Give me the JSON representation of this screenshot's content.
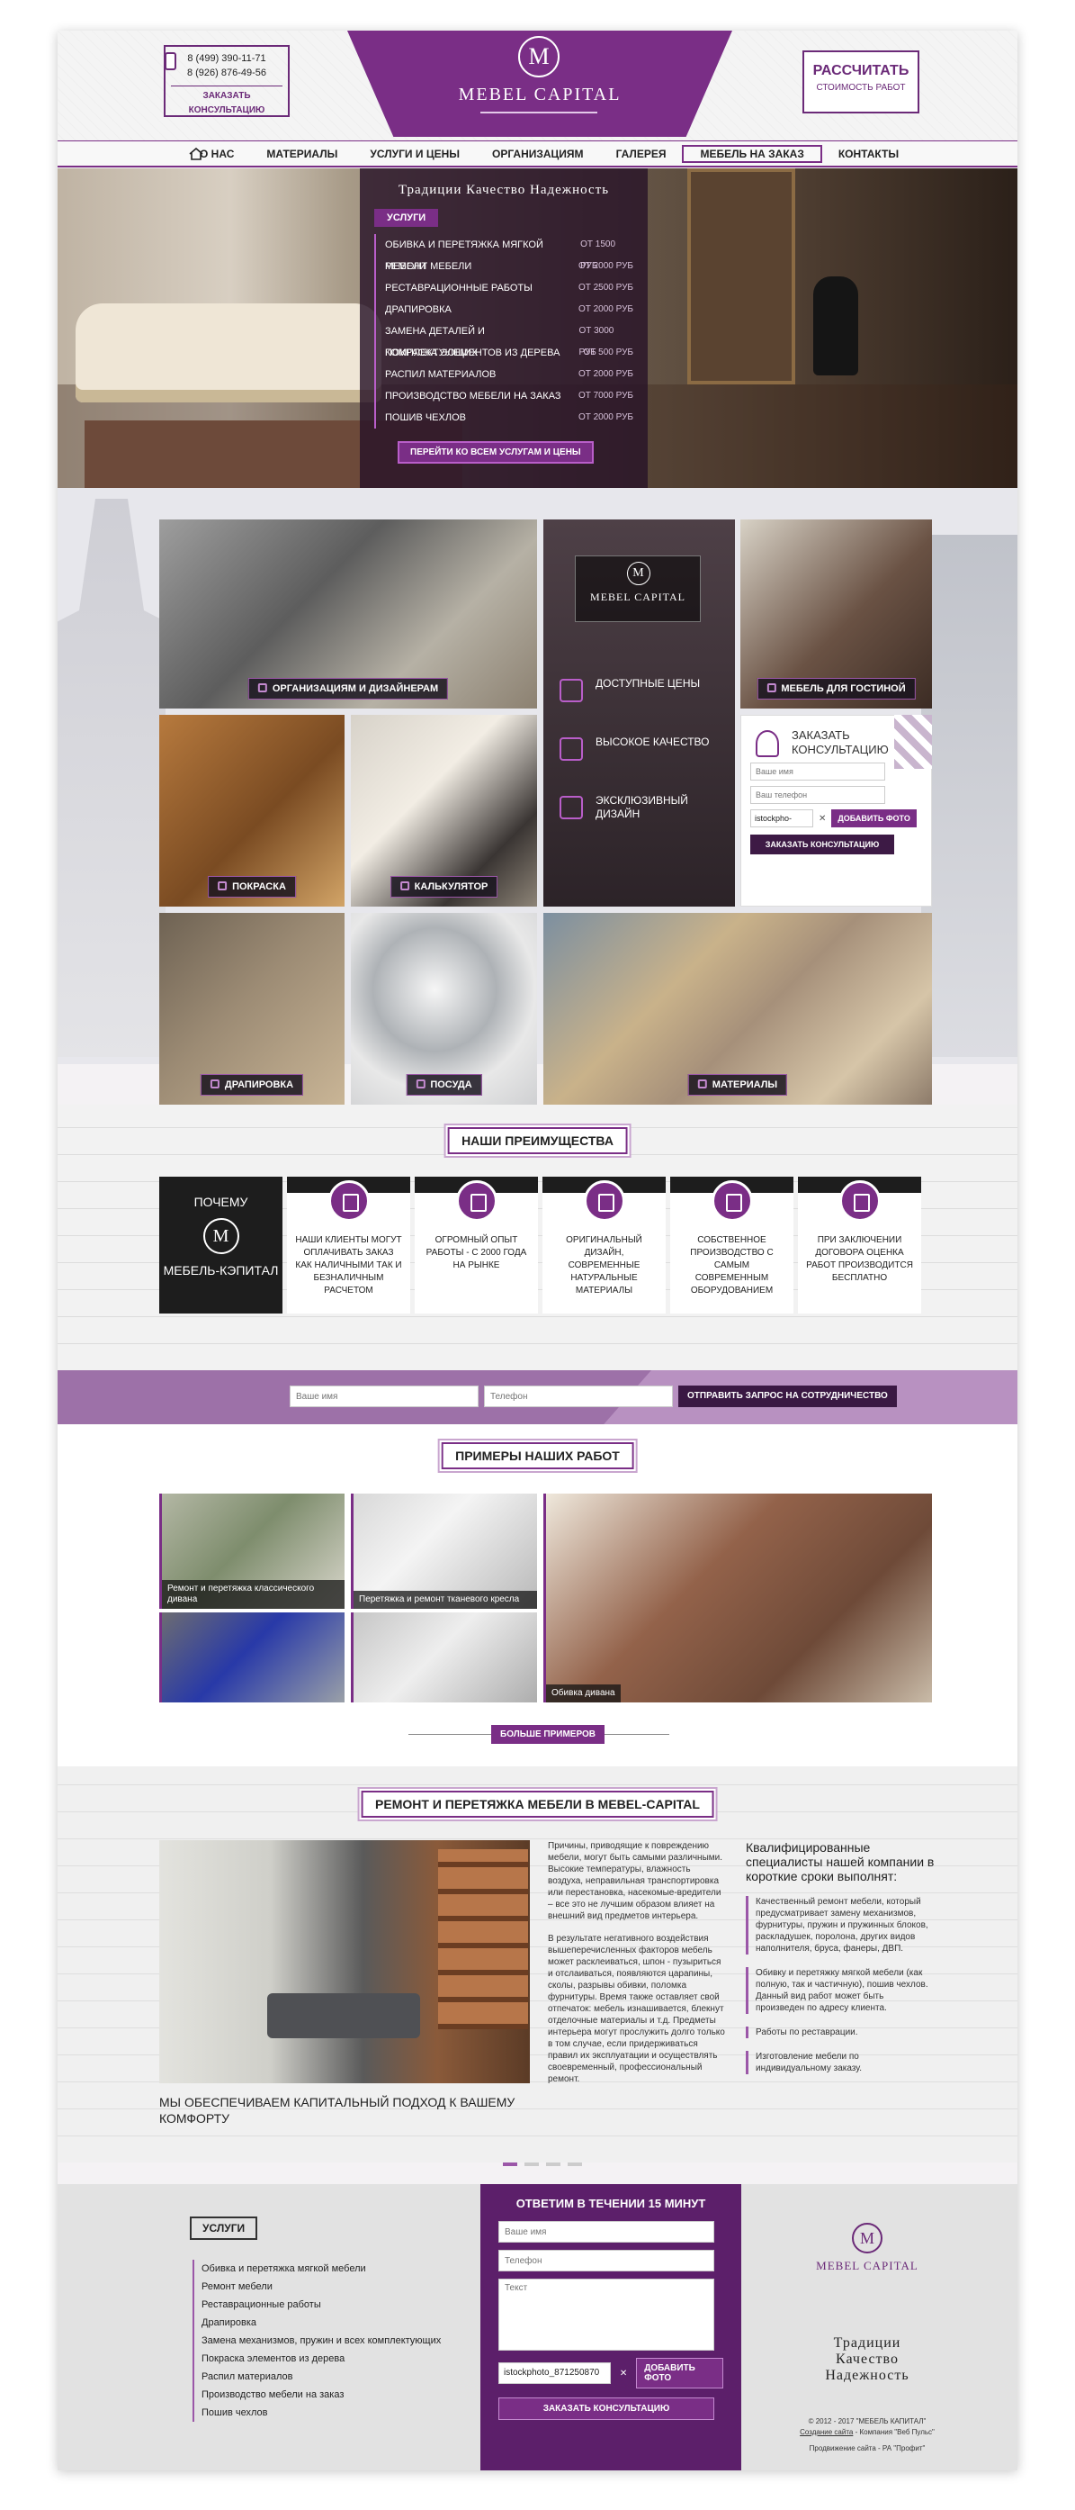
{
  "header": {
    "phones": [
      "8 (499) 390-11-71",
      "8 (926) 876-49-56"
    ],
    "callback_label": "Заказать консультацию",
    "logo_letter": "M",
    "logo_text": "MEBEL CAPITAL",
    "calc_big": "Рассчитать",
    "calc_small": "стоимость работ"
  },
  "nav": {
    "items": [
      "О нас",
      "Материалы",
      "Услуги и цены",
      "Организациям",
      "Галерея",
      "Мебель на заказ",
      "Контакты"
    ],
    "active_index": 5
  },
  "hero": {
    "motto": "Традиции  Качество  Надежность",
    "services_tag": "Услуги",
    "services": [
      {
        "name": "Обивка и перетяжка мягкой мебели",
        "price": "от 1500 руб"
      },
      {
        "name": "Ремонт мебели",
        "price": "от 2000 руб"
      },
      {
        "name": "Реставрационные работы",
        "price": "от 2500 руб"
      },
      {
        "name": "Драпировка",
        "price": "от 2000 руб"
      },
      {
        "name": "Замена деталей и комплектующих",
        "price": "от 3000 руб"
      },
      {
        "name": "Покраска элементов из дерева",
        "price": "от 500 руб"
      },
      {
        "name": "Распил материалов",
        "price": "от 2000 руб"
      },
      {
        "name": "Производство мебели на заказ",
        "price": "от 7000 руб"
      },
      {
        "name": "Пошив чехлов",
        "price": "от 2000 руб"
      }
    ],
    "all_services_label": "Перейти ко всем услугам и цены"
  },
  "tiles": {
    "organizations": "Организациям и дизайнерам",
    "living_room": "Мебель для гостиной",
    "painting": "Покраска",
    "calculator": "Калькулятор",
    "draping": "Драпировка",
    "dishes": "Посуда",
    "materials": "Материалы",
    "brand_logo_text": "MEBEL CAPITAL",
    "features": [
      "Доступные цены",
      "Высокое качество",
      "Эксклюзивный дизайн"
    ]
  },
  "consult": {
    "title": "Заказать консультацию",
    "name_placeholder": "Ваше имя",
    "phone_placeholder": "Ваш телефон",
    "file_name": "istockpho-",
    "add_photo": "Добавить фото",
    "submit": "Заказать консультацию"
  },
  "advantages": {
    "title": "Наши преимущества",
    "why_top": "Почему",
    "why_bottom": "Мебель-Кэпитал",
    "items": [
      "Наши клиенты могут оплачивать заказ как наличными так и безналичным расчетом",
      "Огромный опыт работы - с 2000 года на рынке",
      "Оригинальный дизайн, современные натуральные материалы",
      "Собственное производство с самым современным оборудованием",
      "При заключении договора оценка работ производится бесплатно"
    ]
  },
  "coop_form": {
    "name_placeholder": "Ваше имя",
    "phone_placeholder": "Телефон",
    "submit": "Отправить запрос на сотрудничество"
  },
  "works": {
    "title": "Примеры наших работ",
    "items": [
      "Ремонт и перетяжка классического дивана",
      "Перетяжка и ремонт тканевого кресла",
      "Обивка дивана"
    ],
    "more_label": "Больше примеров"
  },
  "repair": {
    "title": "Ремонт и перетяжка мебели в Mebel-Capital",
    "caption": "Мы обеспечиваем капитальный подход к вашему комфорту",
    "paragraph1": "Причины, приводящие к повреждению мебели, могут быть самыми различными. Высокие температуры, влажность воздуха, неправильная транспортировка или перестановка, насекомые-вредители – все это не лучшим образом влияет на внешний вид предметов интерьера.",
    "paragraph2": "В результате негативного воздействия вышеперечисленных факторов мебель может расклеиваться, шпон - пузыриться и отслаиваться, появляются царапины, сколы, разрывы обивки, поломка фурнитуры. Время также оставляет свой отпечаток: мебель изнашивается, блекнут отделочные материалы и т.д. Предметы интерьера могут прослужить долго только в том случае, если придерживаться правил их эксплуатации и осуществлять своевременный, профессиональный ремонт.",
    "qual_title": "Квалифицированные специалисты нашей компании в короткие сроки выполнят:",
    "qual_items": [
      "Качественный ремонт мебели, который предусматривает замену механизмов, фурнитуры, пружин и пружинных блоков, раскладушек, поролона, других видов наполнителя, бруса, фанеры, ДВП.",
      "Обивку и перетяжку мягкой мебели (как полную, так и частичную), пошив чехлов. Данный вид работ может быть произведен по адресу клиента.",
      "Работы по реставрации.",
      "Изготовление мебели по индивидуальному заказу."
    ]
  },
  "footer": {
    "services_tag": "Услуги",
    "links": [
      "Обивка и перетяжка мягкой мебели",
      "Ремонт мебели",
      "Реставрационные работы",
      "Драпировка",
      "Замена механизмов, пружин и всех комплектующих",
      "Покраска элементов из дерева",
      "Распил материалов",
      "Производство мебели на заказ",
      "Пошив чехлов"
    ],
    "callback_title": "Ответим в течении 15 минут",
    "name_placeholder": "Ваше имя",
    "phone_placeholder": "Телефон",
    "text_placeholder": "Текст",
    "file_name": "istockphoto_871250870",
    "add_photo": "Добавить фото",
    "submit": "Заказать консультацию",
    "logo_text": "MEBEL CAPITAL",
    "motto": [
      "Традиции",
      "Качество",
      "Надежность"
    ],
    "copyright": "© 2012 - 2017 \"МЕБЕЛЬ КАПИТАЛ\"",
    "created_link": "Создание сайта",
    "created_by": "- Компания \"Веб Пульс\"",
    "promotion": "Продвижение сайта - РА \"Профит\""
  },
  "colors": {
    "accent": "#7a2e86",
    "accent_dark": "#3d1a45"
  }
}
